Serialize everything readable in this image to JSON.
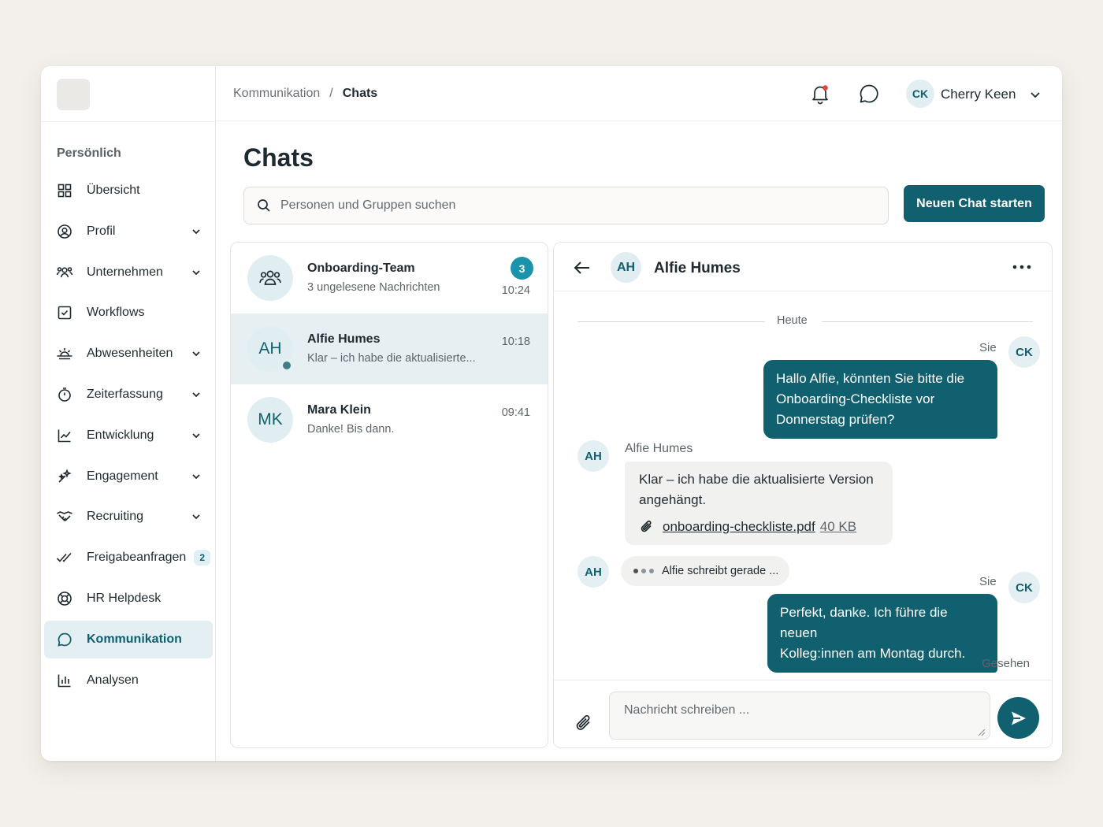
{
  "breadcrumb": {
    "parent": "Kommunikation",
    "separator": "/",
    "current": "Chats"
  },
  "user": {
    "initials": "CK",
    "name": "Cherry Keen"
  },
  "sidebar": {
    "section": "Persönlich",
    "items": [
      {
        "label": "Übersicht",
        "icon": "grid-icon",
        "expandable": false
      },
      {
        "label": "Profil",
        "icon": "user-circle-icon",
        "expandable": true
      },
      {
        "label": "Unternehmen",
        "icon": "users-icon",
        "expandable": true
      },
      {
        "label": "Workflows",
        "icon": "checkbox-icon",
        "expandable": false
      },
      {
        "label": "Abwesenheiten",
        "icon": "sunrise-icon",
        "expandable": true
      },
      {
        "label": "Zeiterfassung",
        "icon": "stopwatch-icon",
        "expandable": true
      },
      {
        "label": "Entwicklung",
        "icon": "trend-chart-icon",
        "expandable": true
      },
      {
        "label": "Engagement",
        "icon": "sparkle-icon",
        "expandable": true
      },
      {
        "label": "Recruiting",
        "icon": "handshake-icon",
        "expandable": true
      },
      {
        "label": "Freigabeanfragen",
        "icon": "double-check-icon",
        "expandable": false,
        "badge": "2"
      },
      {
        "label": "HR Helpdesk",
        "icon": "lifebuoy-icon",
        "expandable": false
      },
      {
        "label": "Kommunikation",
        "icon": "chat-bubble-icon",
        "expandable": false,
        "active": true
      },
      {
        "label": "Analysen",
        "icon": "bar-chart-icon",
        "expandable": false
      }
    ]
  },
  "main": {
    "title": "Chats",
    "search_placeholder": "Personen und Gruppen suchen",
    "new_chat_label": "Neuen Chat starten"
  },
  "conversations": [
    {
      "name": "Onboarding-Team",
      "preview": "3 ungelesene Nachrichten",
      "time": "10:24",
      "unread": "3",
      "avatar": "group-icon"
    },
    {
      "name": "Alfie Humes",
      "preview": "Klar – ich habe die aktualisierte...",
      "time": "10:18",
      "initials": "AH",
      "online": true,
      "selected": true
    },
    {
      "name": "Mara Klein",
      "preview": "Danke! Bis dann.",
      "time": "09:41",
      "initials": "MK"
    }
  ],
  "thread": {
    "contact_initials": "AH",
    "contact_name": "Alfie Humes",
    "day_label": "Heute",
    "self_label": "Sie",
    "self_initials": "CK",
    "messages": [
      {
        "from": "self",
        "lines": [
          "Hallo Alfie, könnten Sie bitte die",
          "Onboarding-Checkliste vor",
          "Donnerstag prüfen?"
        ]
      },
      {
        "from": "other",
        "sender": "Alfie Humes",
        "lines": [
          "Klar – ich habe die aktualisierte Version",
          "angehängt."
        ],
        "attachment": {
          "file": "onboarding-checkliste.pdf",
          "size": "40 KB"
        }
      },
      {
        "from": "self",
        "lines": [
          "Perfekt, danke. Ich führe die neuen",
          "Kolleg:innen am Montag durch."
        ]
      }
    ],
    "typing": "Alfie schreibt gerade ...",
    "seen": "Gesehen",
    "composer_placeholder": "Nachricht schreiben ..."
  },
  "colors": {
    "accent": "#10606f",
    "unread_badge": "#1c93ad",
    "selected_row": "#e6f0f3",
    "background": "#f3f0eb"
  }
}
